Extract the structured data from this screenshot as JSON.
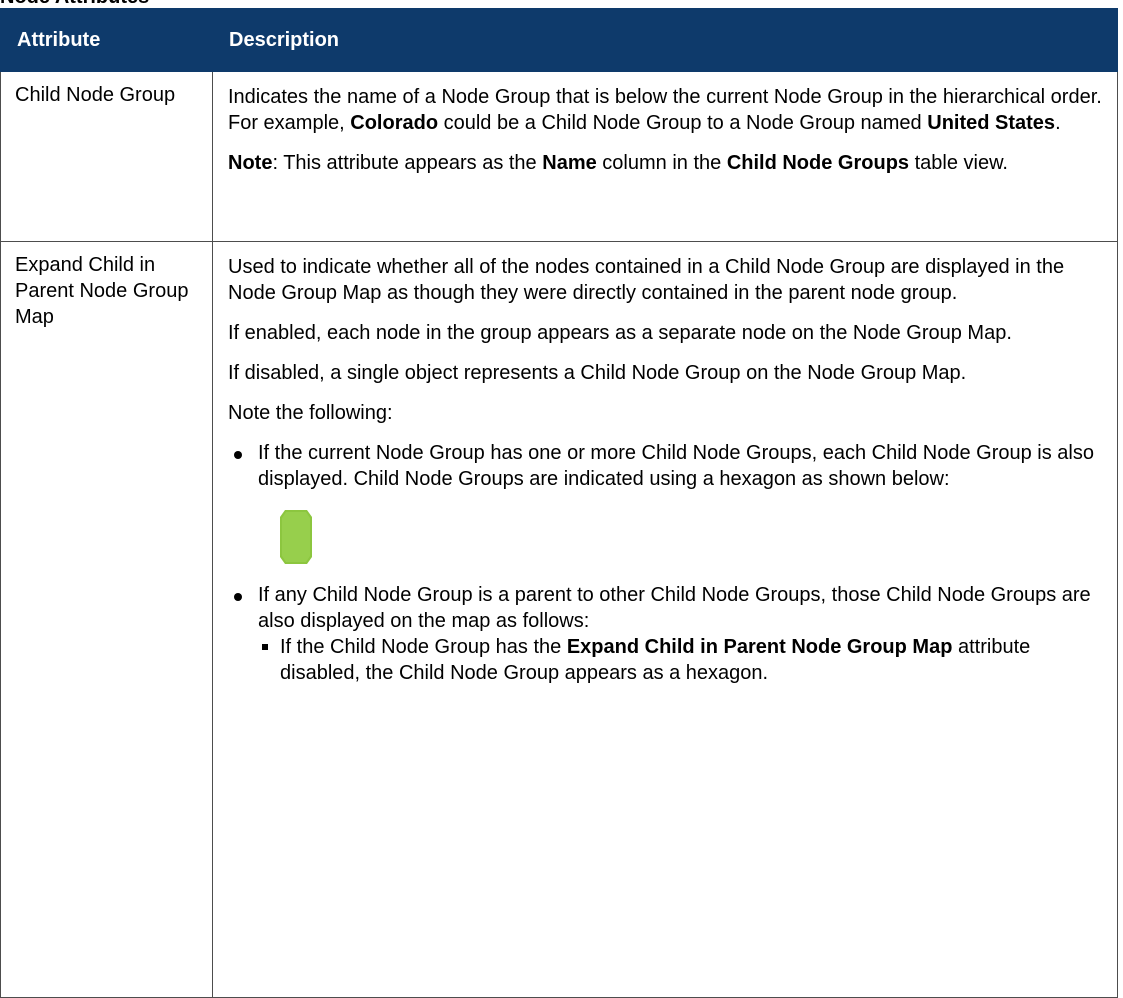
{
  "heading": "Node Attributes",
  "table": {
    "headers": [
      "Attribute",
      "Description"
    ],
    "row1": {
      "name": "Child Node Group",
      "desc": {
        "p1_a": "Indicates the name of a Node Group that is below the current Node Group in the hierarchical order. For example, ",
        "p1_b": "Colorado",
        "p1_c": " could be a Child Node Group to a Node Group named ",
        "p1_d": "United States",
        "p1_e": ".",
        "note_label": "Note",
        "note_a": ": This attribute appears as the ",
        "note_b": "Name",
        "note_c": " column in the ",
        "note_d": "Child Node Groups",
        "note_e": " table view."
      }
    },
    "row2": {
      "name": "Expand Child in Parent Node Group Map",
      "desc": {
        "p1": "Used to indicate whether all of the nodes contained in a Child Node Group are displayed in the Node Group Map as though they were directly contained in the parent node group.",
        "p2": "If enabled, each node in the group appears as a separate node on the Node Group Map.",
        "p3": "If disabled, a single object represents a Child Node Group on the Node Group Map.",
        "p4": "Note the following:",
        "bullet1": "If the current Node Group has one or more Child Node Groups, each Child Node Group is also displayed. Child Node Groups are indicated using a hexagon as shown below:",
        "bullet2": "If any Child Node Group is a parent to other Child Node Groups, those Child Node Groups are also displayed on the map as follows:",
        "sub1_a": "If the Child Node Group has the ",
        "sub1_b": "Expand Child in Parent Node Group Map",
        "sub1_c": " attribute disabled, the Child Node Group appears as a hexagon."
      }
    }
  },
  "icons": {
    "hexagon": "hexagon-icon",
    "hexagon_color": "#8cc63f"
  },
  "colors": {
    "header_bg": "#0e3a6b",
    "header_text": "#ffffff",
    "border": "#4d4d4d"
  }
}
